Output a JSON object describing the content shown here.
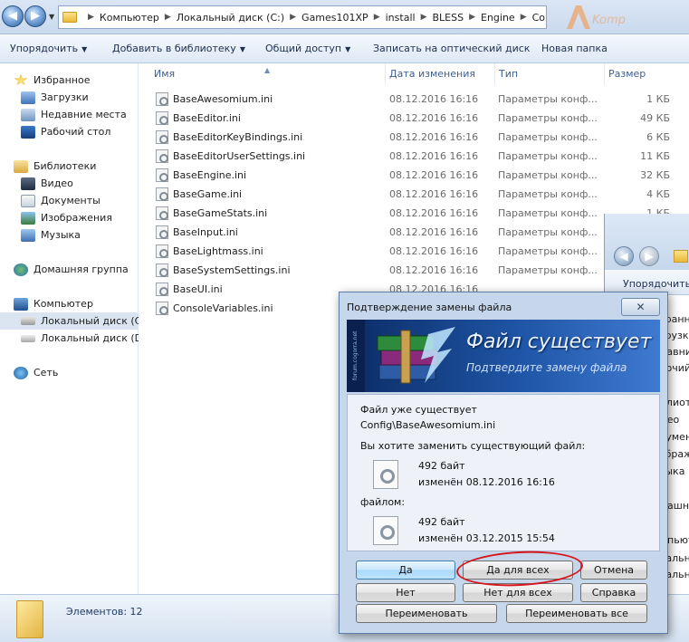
{
  "address": {
    "crumbs": [
      "Компьютер",
      "Локальный диск (C:)",
      "Games101XP",
      "install",
      "BLESS",
      "Engine",
      "Config"
    ],
    "watermark": "Komпут"
  },
  "toolbar": {
    "organize": "Упорядочить",
    "add_library": "Добавить в библиотеку",
    "share": "Общий доступ",
    "burn": "Записать на оптический диск",
    "new_folder": "Новая папка"
  },
  "nav": {
    "favorites": "Избранное",
    "downloads": "Загрузки",
    "recent": "Недавние места",
    "desktop": "Рабочий стол",
    "libraries": "Библиотеки",
    "video": "Видео",
    "documents": "Документы",
    "images": "Изображения",
    "music": "Музыка",
    "homegroup": "Домашняя группа",
    "computer": "Компьютер",
    "drive_c": "Локальный диск (C",
    "drive_d": "Локальный диск (D:)",
    "network": "Сеть"
  },
  "columns": {
    "name": "Имя",
    "date": "Дата изменения",
    "type": "Тип",
    "size": "Размер"
  },
  "files": [
    {
      "name": "BaseAwesomium.ini",
      "date": "08.12.2016 16:16",
      "type": "Параметры конф...",
      "size": "1 КБ"
    },
    {
      "name": "BaseEditor.ini",
      "date": "08.12.2016 16:16",
      "type": "Параметры конф...",
      "size": "49 КБ"
    },
    {
      "name": "BaseEditorKeyBindings.ini",
      "date": "08.12.2016 16:16",
      "type": "Параметры конф...",
      "size": "6 КБ"
    },
    {
      "name": "BaseEditorUserSettings.ini",
      "date": "08.12.2016 16:16",
      "type": "Параметры конф...",
      "size": "11 КБ"
    },
    {
      "name": "BaseEngine.ini",
      "date": "08.12.2016 16:16",
      "type": "Параметры конф...",
      "size": "32 КБ"
    },
    {
      "name": "BaseGame.ini",
      "date": "08.12.2016 16:16",
      "type": "Параметры конф...",
      "size": "4 КБ"
    },
    {
      "name": "BaseGameStats.ini",
      "date": "08.12.2016 16:16",
      "type": "Параметры конф...",
      "size": "1 КБ"
    },
    {
      "name": "BaseInput.ini",
      "date": "08.12.2016 16:16",
      "type": "Параметры конф...",
      "size": ""
    },
    {
      "name": "BaseLightmass.ini",
      "date": "08.12.2016 16:16",
      "type": "Параметры конф...",
      "size": ""
    },
    {
      "name": "BaseSystemSettings.ini",
      "date": "08.12.2016 16:16",
      "type": "Параметры конф...",
      "size": ""
    },
    {
      "name": "BaseUI.ini",
      "date": "08.12.2016 16:16",
      "type": "",
      "size": ""
    },
    {
      "name": "ConsoleVariables.ini",
      "date": "",
      "type": "",
      "size": ""
    }
  ],
  "win2": {
    "toolbar": "Упорядочить",
    "items": [
      "збранное",
      "агрузки",
      "едавние",
      "абочий ст",
      "иблиотек",
      "идео",
      "окументы",
      "зображе",
      "узыка",
      "омашняя",
      "омпьюте",
      "окальный",
      "окальный"
    ]
  },
  "status": {
    "count": "Элементов: 12"
  },
  "dialog": {
    "title": "Подтверждение замены файла",
    "close": "✕",
    "banner_title": "Файл существует",
    "banner_sub": "Подтвердите замену файла",
    "banner_side": "forum.cogorra.net",
    "exists_label": "Файл уже существует",
    "path": "Config\\BaseAwesomium.ini",
    "question": "Вы хотите заменить существующий файл:",
    "existing_size": "492 байт",
    "existing_date": "изменён 08.12.2016 16:16",
    "with_label": "файлом:",
    "new_size": "492 байт",
    "new_date": "изменён 03.12.2015 15:54",
    "buttons": {
      "yes": "Да",
      "yes_all": "Да для всех",
      "cancel": "Отмена",
      "no": "Нет",
      "no_all": "Нет для всех",
      "help": "Справка",
      "rename": "Переименовать",
      "rename_all": "Переименовать все"
    }
  },
  "colors": {
    "accent": "#3c5f92",
    "dialog_bg": "#c6d7ec",
    "highlight_circle": "#d6161c"
  }
}
